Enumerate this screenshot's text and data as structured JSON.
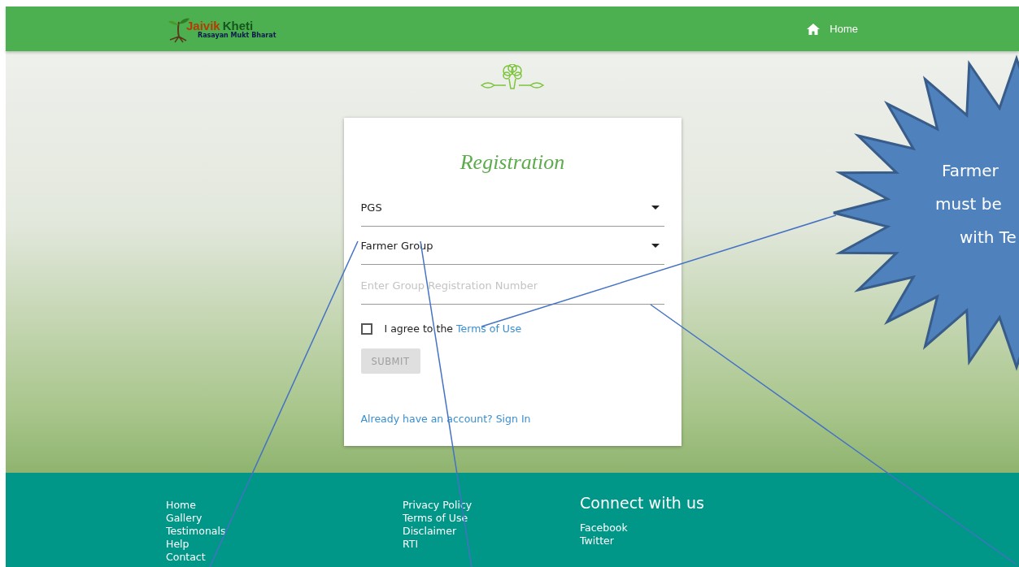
{
  "header": {
    "logo": {
      "word_1": "Jaivik",
      "word_2": "Kheti",
      "tagline": "Rasayan Mukt Bharat"
    },
    "nav": [
      {
        "label": "Home"
      }
    ]
  },
  "form": {
    "title": "Registration",
    "selects": [
      {
        "value": "PGS"
      },
      {
        "value": "Farmer Group"
      }
    ],
    "input": {
      "placeholder": "Enter Group Registration Number"
    },
    "agree": {
      "checked": false,
      "text": "I agree to the",
      "link": "Terms of Use"
    },
    "submit": {
      "label": "SUBMIT",
      "disabled": true
    },
    "signin": "Already have an account? Sign In"
  },
  "footer": {
    "column_1": [
      "Home",
      "Gallery",
      "Testimonals",
      "Help",
      "Contact"
    ],
    "column_2": [
      "Privacy Policy",
      "Terms of Use",
      "Disclaimer",
      "RTI"
    ],
    "connect": {
      "title": "Connect with us",
      "links": [
        "Facebook",
        "Twitter"
      ]
    }
  },
  "callout": {
    "lines": [
      "Farmer",
      "must be",
      "with Te"
    ]
  }
}
